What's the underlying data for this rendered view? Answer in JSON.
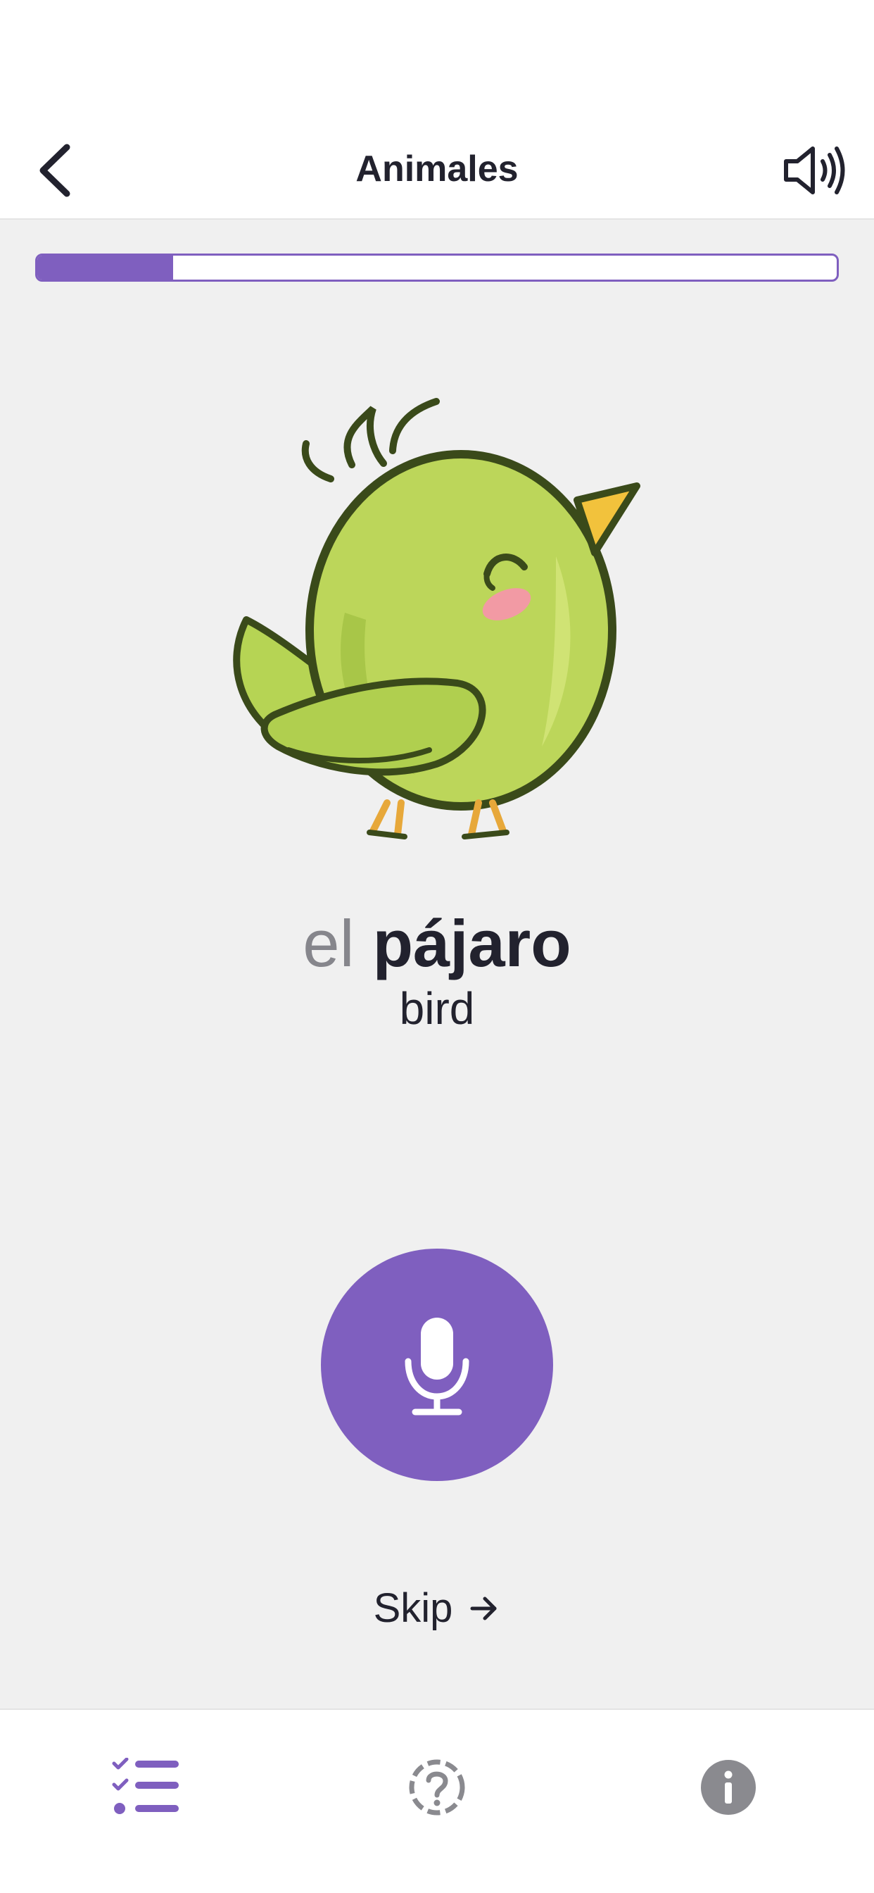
{
  "header": {
    "title": "Animales"
  },
  "progress": {
    "value_fraction": 0.17
  },
  "card": {
    "article": "el",
    "word": "pájaro",
    "translation": "bird",
    "image_icon": "bird-illustration"
  },
  "actions": {
    "mic_icon": "microphone-icon",
    "skip_label": "Skip"
  },
  "icons": {
    "back": "chevron-left-icon",
    "sound": "speaker-icon",
    "skip": "arrow-right-icon",
    "tab_practice": "checklist-icon",
    "tab_quiz": "question-circle-icon",
    "tab_info": "info-icon"
  },
  "colors": {
    "accent": "#7f5fbf",
    "background": "#f0f0f0",
    "text": "#22222e",
    "muted_text": "#86868c",
    "inactive_icon": "#8a8a8f"
  },
  "bottom_nav": {
    "active_tab": "practice"
  }
}
